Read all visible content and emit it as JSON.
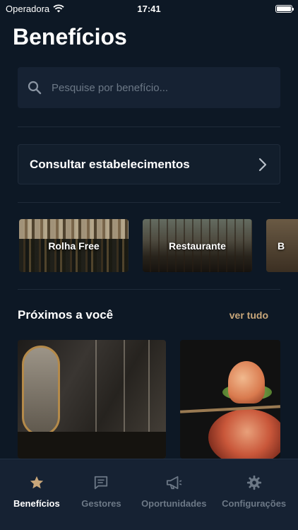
{
  "status_bar": {
    "carrier": "Operadora",
    "time": "17:41",
    "battery_level": 1.0
  },
  "header": {
    "title": "Benefícios"
  },
  "search": {
    "placeholder": "Pesquise por benefício..."
  },
  "consult": {
    "label": "Consultar estabelecimentos"
  },
  "categories": [
    {
      "label": "Rolha Free"
    },
    {
      "label": "Restaurante"
    },
    {
      "label": "B"
    }
  ],
  "nearby": {
    "title": "Próximos a você",
    "see_all": "ver tudo"
  },
  "tabs": [
    {
      "label": "Benefícios",
      "icon": "star-icon",
      "active": true
    },
    {
      "label": "Gestores",
      "icon": "chat-icon",
      "active": false
    },
    {
      "label": "Oportunidades",
      "icon": "megaphone-icon",
      "active": false
    },
    {
      "label": "Configurações",
      "icon": "gear-icon",
      "active": false
    }
  ],
  "colors": {
    "background": "#0d1825",
    "accent": "#c9a77a",
    "surface": "#162233",
    "inactive": "#6c7886"
  }
}
